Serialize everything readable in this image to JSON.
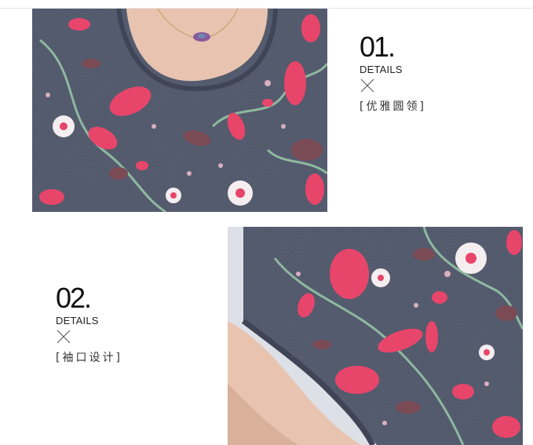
{
  "sections": [
    {
      "number": "01.",
      "label": "DETAILS",
      "subtitle": "[优雅圆领]",
      "image_subject": "neckline-closeup-photo"
    },
    {
      "number": "02.",
      "label": "DETAILS",
      "subtitle": "[袖口设计]",
      "image_subject": "sleeve-closeup-photo"
    }
  ],
  "icons": {
    "divider_mark": "cross-icon"
  },
  "colors": {
    "fabric_base": "#4d5466",
    "petal_pink": "#e8456a",
    "petal_white": "#f4eef0",
    "leaf_green": "#8fb8a0",
    "skin": "#e8c4b0",
    "background": "#ffffff"
  }
}
